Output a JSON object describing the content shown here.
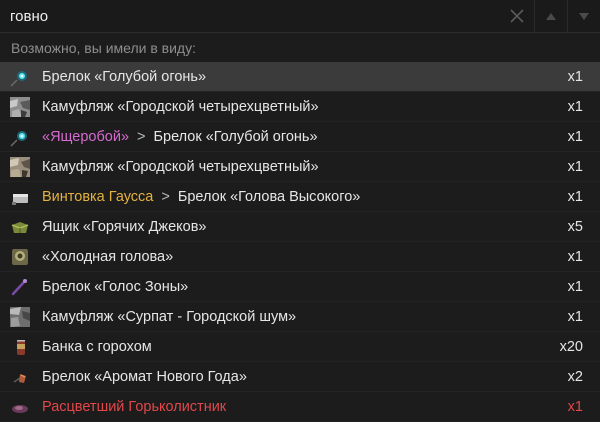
{
  "search": {
    "query": "говно"
  },
  "hint": "Возможно, вы имели в виду:",
  "colors": {
    "pink": "#d66bd0",
    "gold": "#e4b23f",
    "red": "#e2474a"
  },
  "results": [
    {
      "parent": "",
      "name": "Брелок «Голубой огонь»",
      "qty": "x1",
      "icon": "blue-fire-charm-icon",
      "selected": true
    },
    {
      "parent": "",
      "name": "Камуфляж «Городской четырехцветный»",
      "qty": "x1",
      "icon": "urban-camo-icon"
    },
    {
      "parent": "«Ящеробой»",
      "parent_color": "pink",
      "name": "Брелок «Голубой огонь»",
      "qty": "x1",
      "icon": "blue-fire-charm-icon"
    },
    {
      "parent": "",
      "name": "Камуфляж «Городской четырехцветный»",
      "qty": "x1",
      "icon": "urban-camo-icon-alt"
    },
    {
      "parent": "Винтовка Гаусса",
      "parent_color": "gold",
      "name": "Брелок «Голова Высокого»",
      "qty": "x1",
      "icon": "gauss-rifle-icon"
    },
    {
      "parent": "",
      "name": "Ящик «Горячих Джеков»",
      "qty": "x5",
      "icon": "crate-icon"
    },
    {
      "parent": "",
      "name": "«Холодная голова»",
      "qty": "x1",
      "icon": "sticker-icon"
    },
    {
      "parent": "",
      "name": "Брелок «Голос Зоны»",
      "qty": "x1",
      "icon": "voice-charm-icon"
    },
    {
      "parent": "",
      "name": "Камуфляж «Сурпат - Городской шум»",
      "qty": "x1",
      "icon": "surpat-camo-icon"
    },
    {
      "parent": "",
      "name": "Банка с горохом",
      "qty": "x20",
      "icon": "can-icon"
    },
    {
      "parent": "",
      "name": "Брелок «Аромат Нового Года»",
      "qty": "x2",
      "icon": "new-year-charm-icon"
    },
    {
      "parent": "",
      "name": "Расцветший Горьколистник",
      "name_color": "red",
      "qty": "x1",
      "icon": "plant-icon"
    }
  ]
}
